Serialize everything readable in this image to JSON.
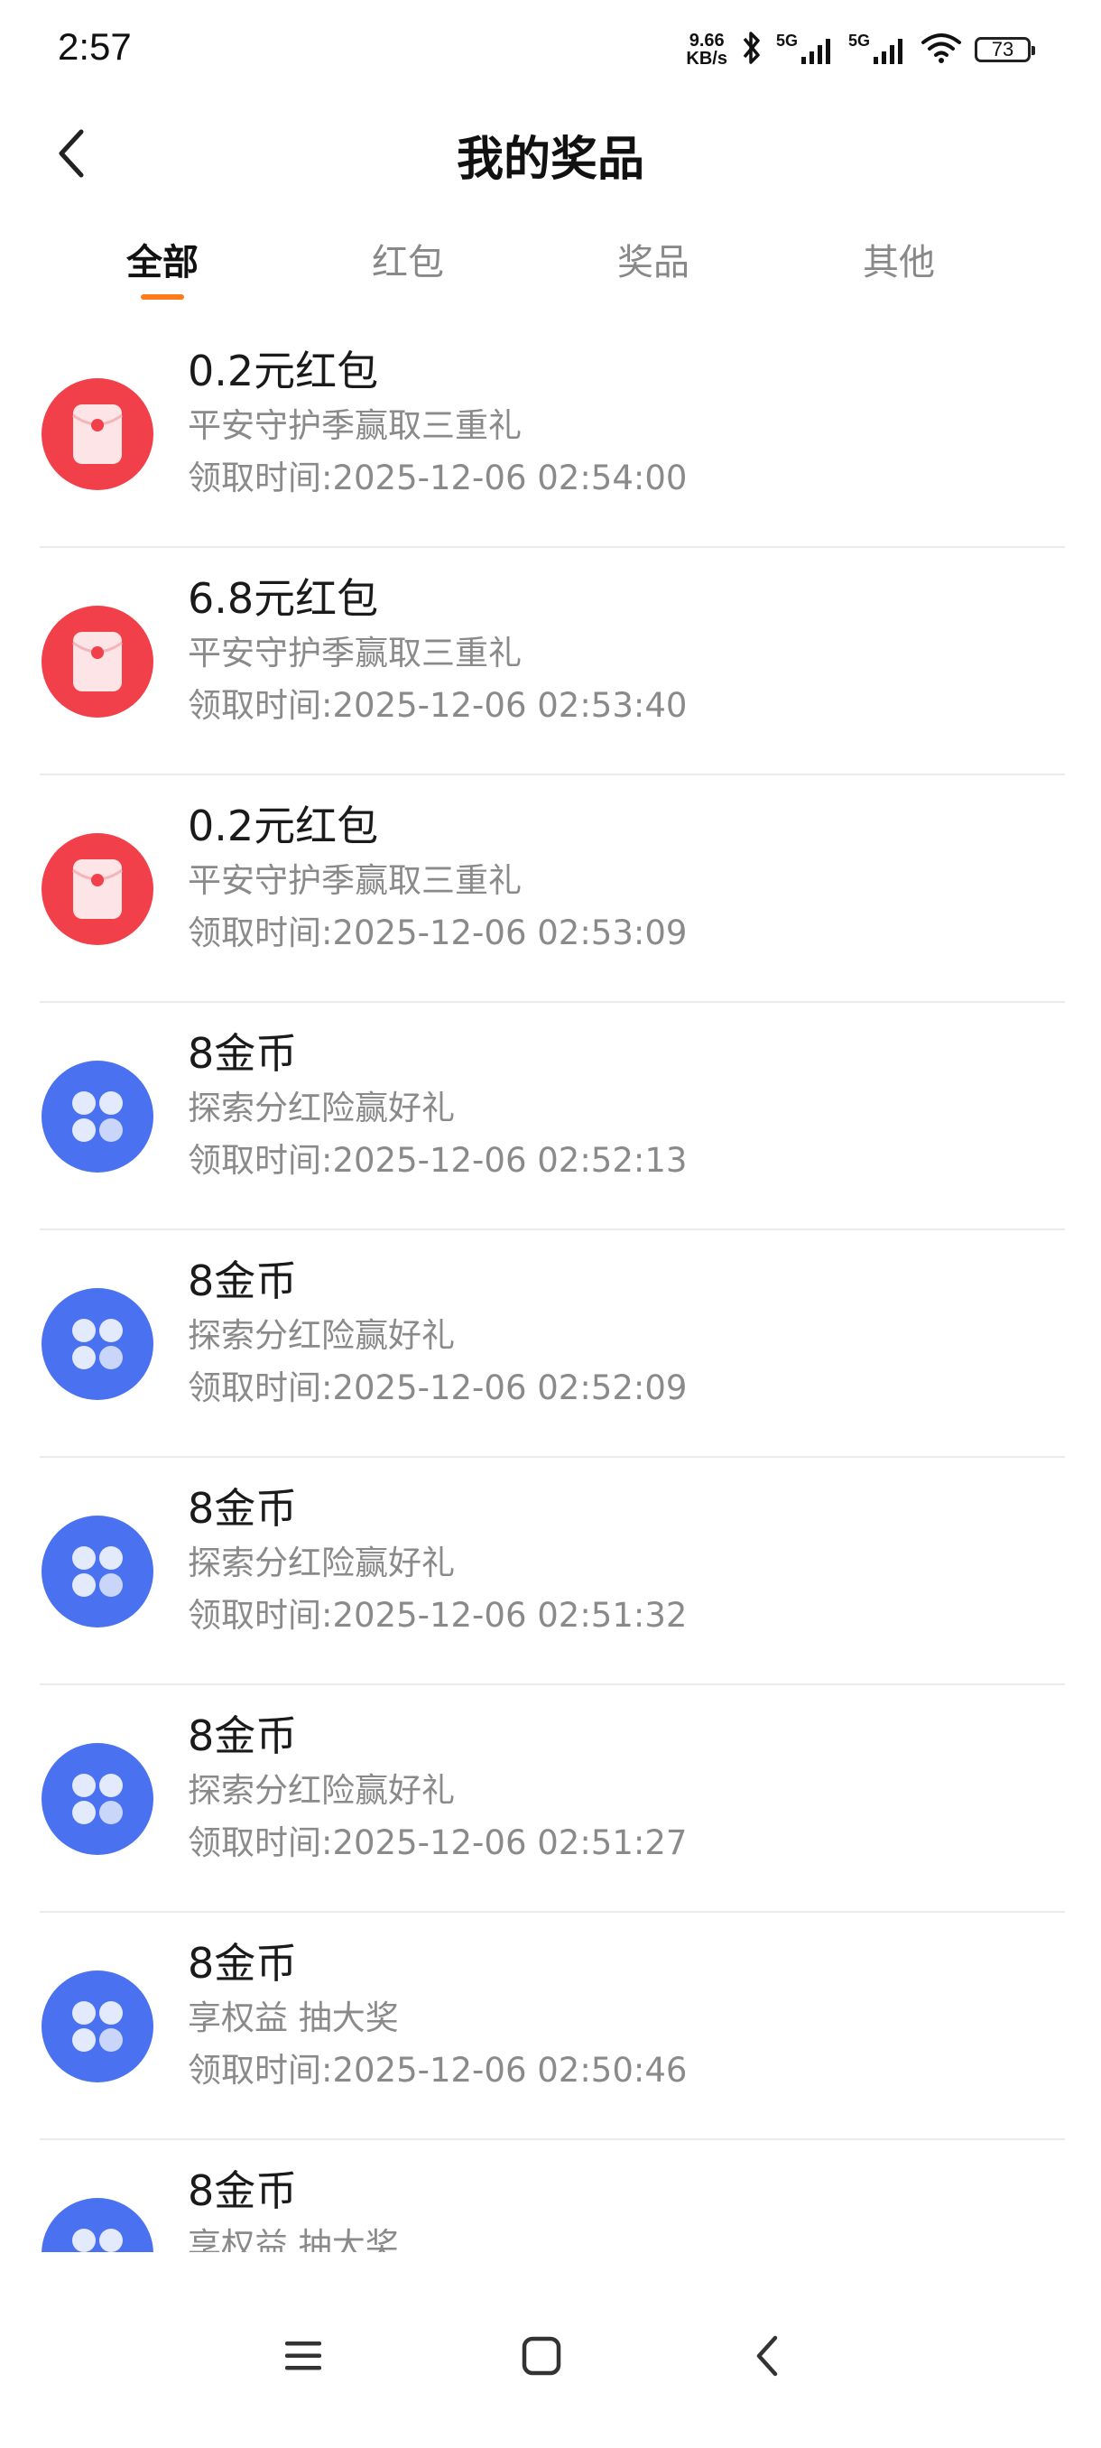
{
  "status_bar": {
    "time": "2:57",
    "net_speed_value": "9.66",
    "net_speed_unit": "KB/s",
    "signal1_label": "5G",
    "signal2_label": "5G",
    "battery": "73"
  },
  "header": {
    "title": "我的奖品"
  },
  "tabs": [
    {
      "label": "全部",
      "active": true
    },
    {
      "label": "红包",
      "active": false
    },
    {
      "label": "奖品",
      "active": false
    },
    {
      "label": "其他",
      "active": false
    }
  ],
  "colors": {
    "accent": "#ff7a1a",
    "red_envelope": "#f2404a",
    "coin_blue": "#4a72f0"
  },
  "prizes": [
    {
      "icon": "red-envelope-icon",
      "title": "0.2元红包",
      "subtitle": "平安守护季赢取三重礼",
      "time": "领取时间:2025-12-06 02:54:00"
    },
    {
      "icon": "red-envelope-icon",
      "title": "6.8元红包",
      "subtitle": "平安守护季赢取三重礼",
      "time": "领取时间:2025-12-06 02:53:40"
    },
    {
      "icon": "red-envelope-icon",
      "title": "0.2元红包",
      "subtitle": "平安守护季赢取三重礼",
      "time": "领取时间:2025-12-06 02:53:09"
    },
    {
      "icon": "gold-coin-icon",
      "title": "8金币",
      "subtitle": "探索分红险赢好礼",
      "time": "领取时间:2025-12-06 02:52:13"
    },
    {
      "icon": "gold-coin-icon",
      "title": "8金币",
      "subtitle": "探索分红险赢好礼",
      "time": "领取时间:2025-12-06 02:52:09"
    },
    {
      "icon": "gold-coin-icon",
      "title": "8金币",
      "subtitle": "探索分红险赢好礼",
      "time": "领取时间:2025-12-06 02:51:32"
    },
    {
      "icon": "gold-coin-icon",
      "title": "8金币",
      "subtitle": "探索分红险赢好礼",
      "time": "领取时间:2025-12-06 02:51:27"
    },
    {
      "icon": "gold-coin-icon",
      "title": "8金币",
      "subtitle": "享权益 抽大奖",
      "time": "领取时间:2025-12-06 02:50:46"
    },
    {
      "icon": "gold-coin-icon",
      "title": "8金币",
      "subtitle": "享权益 抽大奖",
      "time": ""
    }
  ]
}
